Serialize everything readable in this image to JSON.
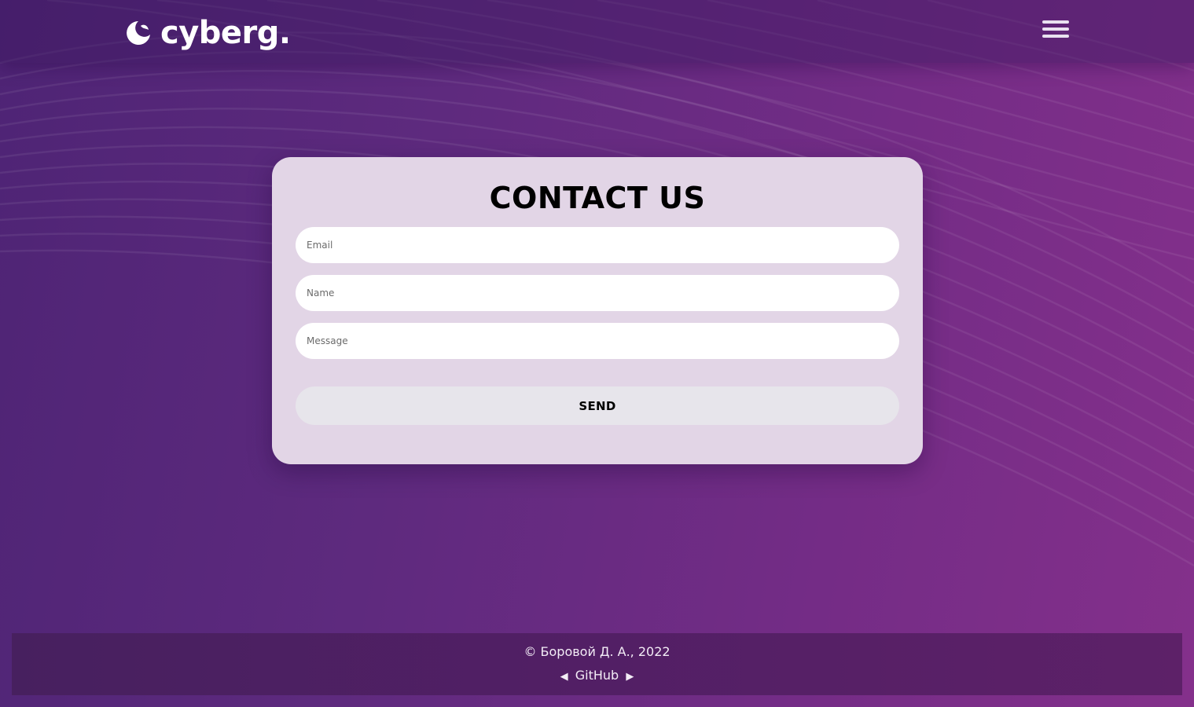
{
  "header": {
    "logo_text": "cyberg.",
    "logo_icon": "crescent-moon-icon",
    "menu_icon": "hamburger-menu-icon"
  },
  "contact": {
    "title": "CONTACT US",
    "email_placeholder": "Email",
    "name_placeholder": "Name",
    "message_placeholder": "Message",
    "send_label": "SEND"
  },
  "footer": {
    "copyright": "© Боровой Д. А., 2022",
    "prev_arrow": "◀",
    "github_label": "GitHub",
    "next_arrow": "▶"
  },
  "colors": {
    "background_start": "#4e2475",
    "background_end": "#84308b",
    "card_background": "#e2d5e6",
    "send_button": "#e7e5eb"
  }
}
